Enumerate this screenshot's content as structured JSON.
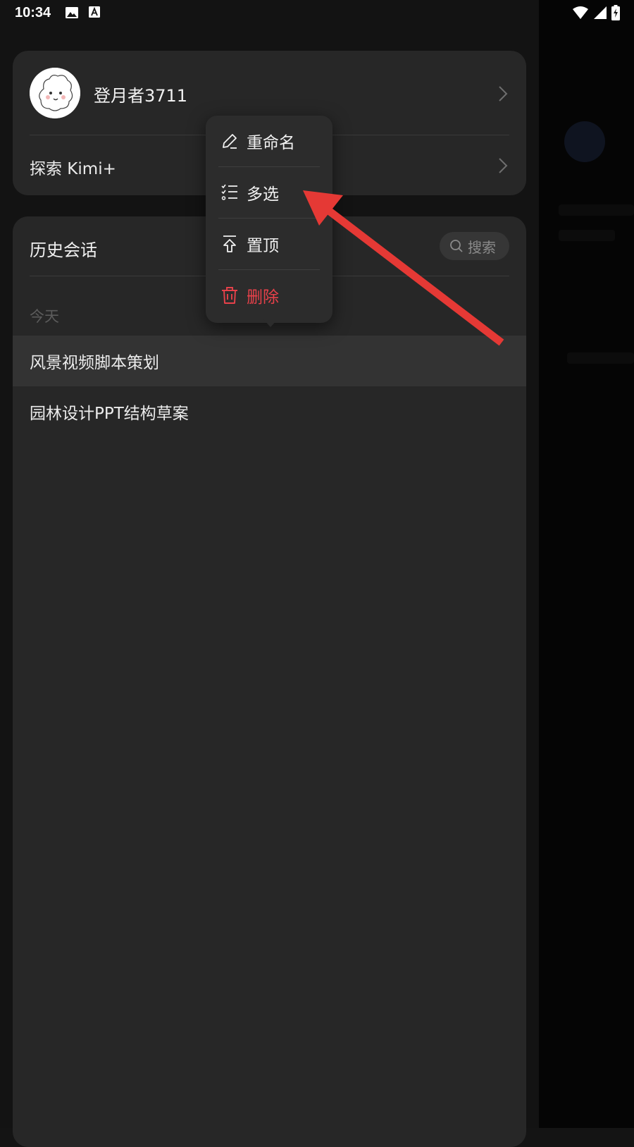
{
  "status_bar": {
    "time": "10:34",
    "left_icons": [
      "image-icon",
      "font-icon"
    ],
    "right_icons": [
      "wifi-icon",
      "signal-icon",
      "battery-charging-icon"
    ]
  },
  "profile": {
    "username": "登月者3711",
    "explore_label": "探索 Kimi+"
  },
  "history": {
    "title": "历史会话",
    "search_placeholder": "搜索",
    "sections": [
      {
        "label": "今天",
        "items": [
          {
            "title": "风景视频脚本策划",
            "selected": true
          },
          {
            "title": "园林设计PPT结构草案",
            "selected": false
          }
        ]
      }
    ]
  },
  "context_menu": {
    "items": [
      {
        "label": "重命名",
        "icon": "pencil-icon"
      },
      {
        "label": "多选",
        "icon": "checklist-icon"
      },
      {
        "label": "置顶",
        "icon": "pin-to-top-icon"
      },
      {
        "label": "删除",
        "icon": "trash-icon",
        "danger": true
      }
    ]
  },
  "colors": {
    "accent_danger": "#e8414a",
    "annotation_arrow": "#e53935",
    "card_bg": "#272727",
    "page_bg": "#141414"
  }
}
